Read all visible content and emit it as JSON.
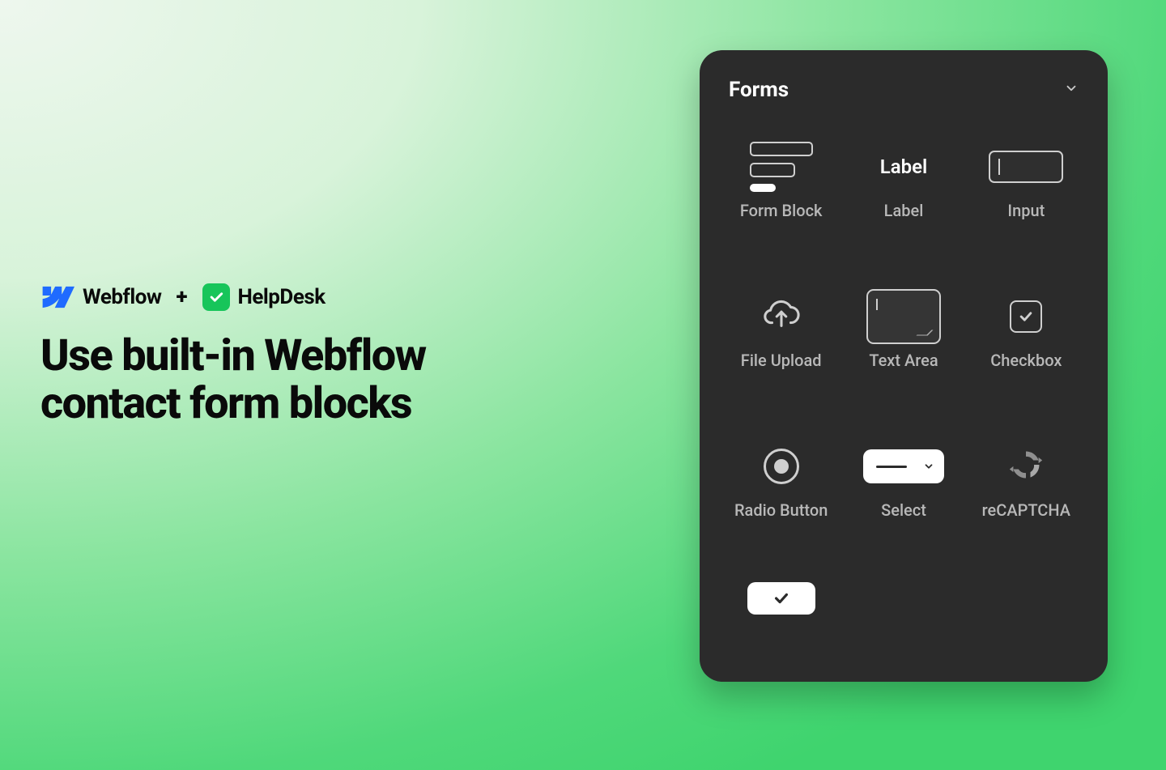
{
  "brands": {
    "webflow": "Webflow",
    "plus": "+",
    "helpdesk": "HelpDesk"
  },
  "heading_line1": "Use built-in Webflow",
  "heading_line2": "contact form blocks",
  "panel": {
    "title": "Forms",
    "items": [
      {
        "key": "form-block",
        "label": "Form Block"
      },
      {
        "key": "label",
        "label": "Label",
        "icon_text": "Label"
      },
      {
        "key": "input",
        "label": "Input"
      },
      {
        "key": "file-upload",
        "label": "File Upload"
      },
      {
        "key": "text-area",
        "label": "Text Area"
      },
      {
        "key": "checkbox",
        "label": "Checkbox"
      },
      {
        "key": "radio-button",
        "label": "Radio Button"
      },
      {
        "key": "select",
        "label": "Select"
      },
      {
        "key": "recaptcha",
        "label": "reCAPTCHA"
      }
    ]
  },
  "colors": {
    "panel_bg": "#2b2b2b",
    "accent_green": "#17c55a",
    "webflow_blue": "#1f6bff"
  }
}
